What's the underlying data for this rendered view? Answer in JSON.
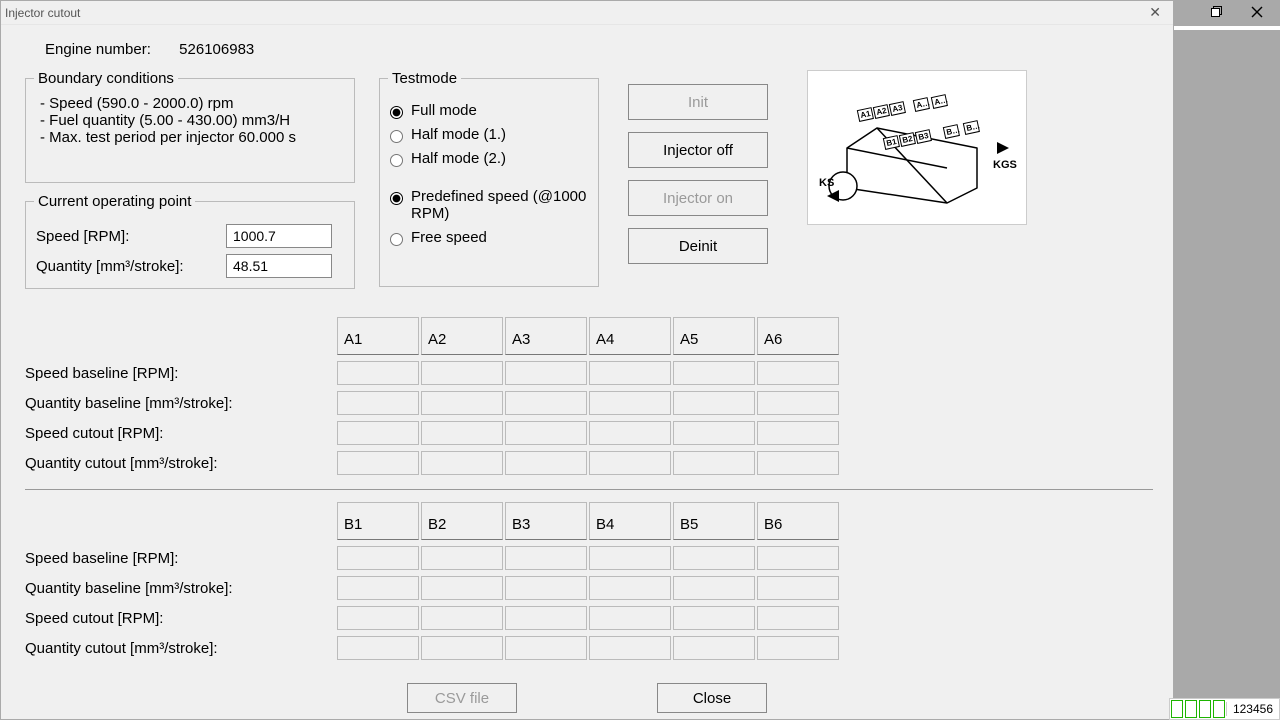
{
  "window": {
    "title": "Injector cutout"
  },
  "engine": {
    "label": "Engine number:",
    "value": "526106983"
  },
  "boundary": {
    "legend": "Boundary conditions",
    "items": [
      "Speed (590.0 - 2000.0) rpm",
      "Fuel quantity (5.00 - 430.00) mm3/H",
      "Max. test period per injector 60.000 s"
    ]
  },
  "operating": {
    "legend": "Current operating point",
    "speed_label": "Speed [RPM]:",
    "speed_value": "1000.7",
    "qty_label": "Quantity [mm³/stroke]:",
    "qty_value": "48.51"
  },
  "testmode": {
    "legend": "Testmode",
    "full": "Full mode",
    "half1": "Half mode (1.)",
    "half2": "Half mode (2.)",
    "predef": "Predefined speed (@1000 RPM)",
    "free": "Free speed",
    "selected_mode": "full",
    "selected_speed": "predef"
  },
  "buttons": {
    "init": "Init",
    "off": "Injector off",
    "on": "Injector on",
    "deinit": "Deinit",
    "csv": "CSV file",
    "close": "Close"
  },
  "diagram": {
    "ks": "KS",
    "kgs": "KGS",
    "a1": "A1",
    "a2": "A2",
    "a3": "A3",
    "a_": "A…",
    "b1": "B1",
    "b2": "B2",
    "b3": "B3",
    "b_": "B…"
  },
  "columnsA": [
    "A1",
    "A2",
    "A3",
    "A4",
    "A5",
    "A6"
  ],
  "columnsB": [
    "B1",
    "B2",
    "B3",
    "B4",
    "B5",
    "B6"
  ],
  "rowsA": [
    "Speed baseline [RPM]:",
    "Quantity baseline [mm³/stroke]:",
    "Speed cutout  [RPM]:",
    "Quantity cutout  [mm³/stroke]:"
  ],
  "rowsB": [
    "Speed baseline [RPM]:",
    "Quantity baseline [mm³/stroke]:",
    "Speed cutout [RPM]:",
    "Quantity cutout [mm³/stroke]:"
  ],
  "status": {
    "num": "123456"
  }
}
